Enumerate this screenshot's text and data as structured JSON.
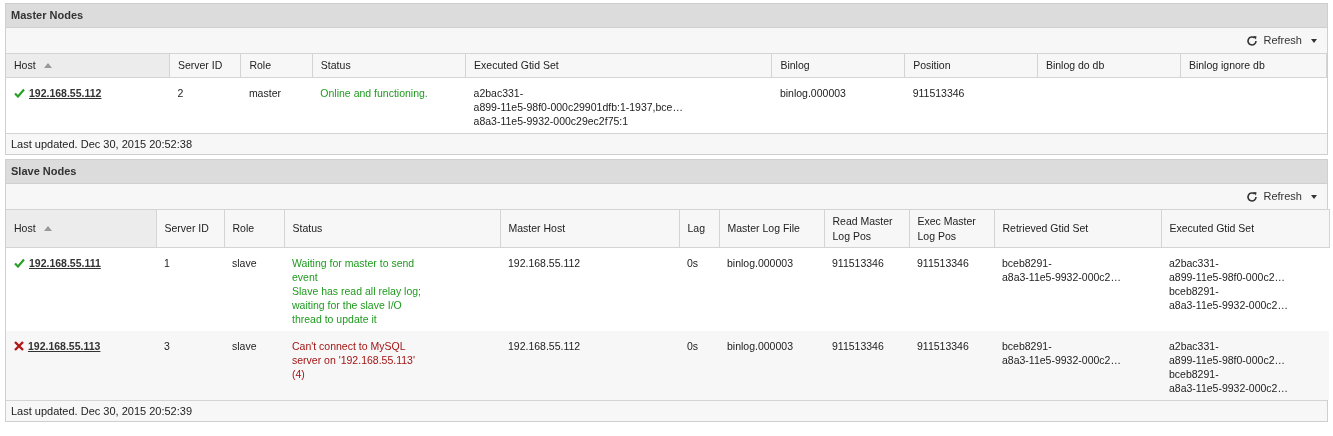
{
  "sections": [
    {
      "title": "Master Nodes",
      "refresh": "Refresh",
      "columns": [
        {
          "label": "Host",
          "sorted": true
        },
        {
          "label": "Server ID",
          "sorted": false
        },
        {
          "label": "Role",
          "sorted": false
        },
        {
          "label": "Status",
          "sorted": false
        },
        {
          "label": "Executed Gtid Set",
          "sorted": false
        },
        {
          "label": "Binlog",
          "sorted": false
        },
        {
          "label": "Position",
          "sorted": false
        },
        {
          "label": "Binlog do db",
          "sorted": false
        },
        {
          "label": "Binlog ignore db",
          "sorted": false
        }
      ],
      "rows": [
        {
          "healthy": true,
          "cells": [
            "192.168.55.112",
            "2",
            "master",
            "Online and functioning.",
            "a2bac331-\na899-11e5-98f0-000c29901dfb:1-1937,bce…\na8a3-11e5-9932-000c29ec2f75:1",
            "binlog.000003",
            "911513346",
            "",
            ""
          ]
        }
      ],
      "footer": "Last updated. Dec 30, 2015 20:52:38"
    },
    {
      "title": "Slave Nodes",
      "refresh": "Refresh",
      "columns": [
        {
          "label": "Host",
          "sorted": true
        },
        {
          "label": "Server ID",
          "sorted": false
        },
        {
          "label": "Role",
          "sorted": false
        },
        {
          "label": "Status",
          "sorted": false
        },
        {
          "label": "Master Host",
          "sorted": false
        },
        {
          "label": "Lag",
          "sorted": false
        },
        {
          "label": "Master Log File",
          "sorted": false
        },
        {
          "label": "Read Master\nLog Pos",
          "sorted": false
        },
        {
          "label": "Exec Master\nLog Pos",
          "sorted": false
        },
        {
          "label": "Retrieved Gtid Set",
          "sorted": false
        },
        {
          "label": "Executed Gtid Set",
          "sorted": false
        }
      ],
      "rows": [
        {
          "healthy": true,
          "cells": [
            "192.168.55.111",
            "1",
            "slave",
            "Waiting for master to send\nevent\nSlave has read all relay log;\nwaiting for the slave I/O\nthread to update it",
            "192.168.55.112",
            "0s",
            "binlog.000003",
            "911513346",
            "911513346",
            "bceb8291-\na8a3-11e5-9932-000c2…",
            "a2bac331-\na899-11e5-98f0-000c2…\nbceb8291-\na8a3-11e5-9932-000c2…"
          ]
        },
        {
          "healthy": false,
          "cells": [
            "192.168.55.113",
            "3",
            "slave",
            "Can't connect to MySQL\nserver on '192.168.55.113'\n(4)",
            "192.168.55.112",
            "0s",
            "binlog.000003",
            "911513346",
            "911513346",
            "bceb8291-\na8a3-11e5-9932-000c2…",
            "a2bac331-\na899-11e5-98f0-000c2…\nbceb8291-\na8a3-11e5-9932-000c2…"
          ]
        }
      ],
      "footer": "Last updated. Dec 30, 2015 20:52:39"
    }
  ]
}
